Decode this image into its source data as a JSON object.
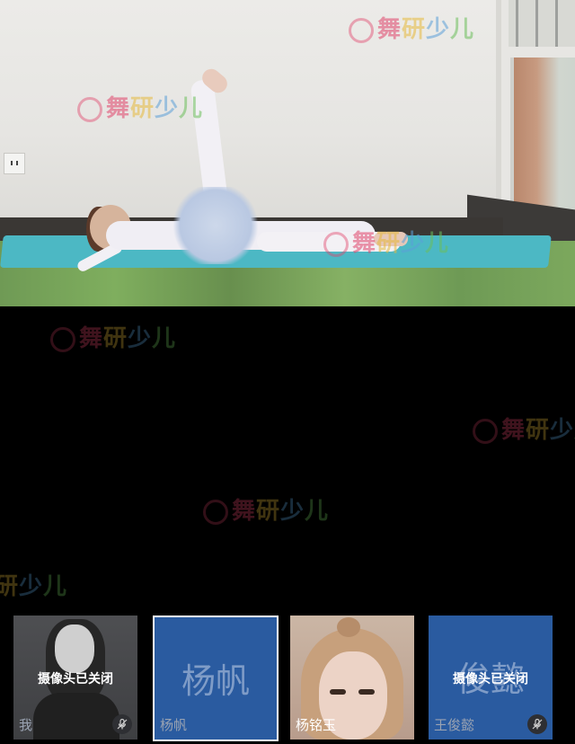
{
  "watermark": {
    "brand": "舞研少儿",
    "chars": [
      "舞",
      "研",
      "少",
      "儿"
    ]
  },
  "participants": [
    {
      "name": "我",
      "camera_status": "摄像头已关闭",
      "muted": true
    },
    {
      "name": "杨帆",
      "avatar_text": "杨帆",
      "selected": true
    },
    {
      "name": "杨铭玉"
    },
    {
      "name": "王俊懿",
      "avatar_text": "俊懿",
      "camera_status": "摄像头已关闭",
      "muted": true
    }
  ],
  "colors": {
    "avatar_bg": "#2a5ba0",
    "background": "#000000",
    "selected_border": "#ffffff"
  },
  "icons": {
    "mute": "mic-muted-icon"
  }
}
